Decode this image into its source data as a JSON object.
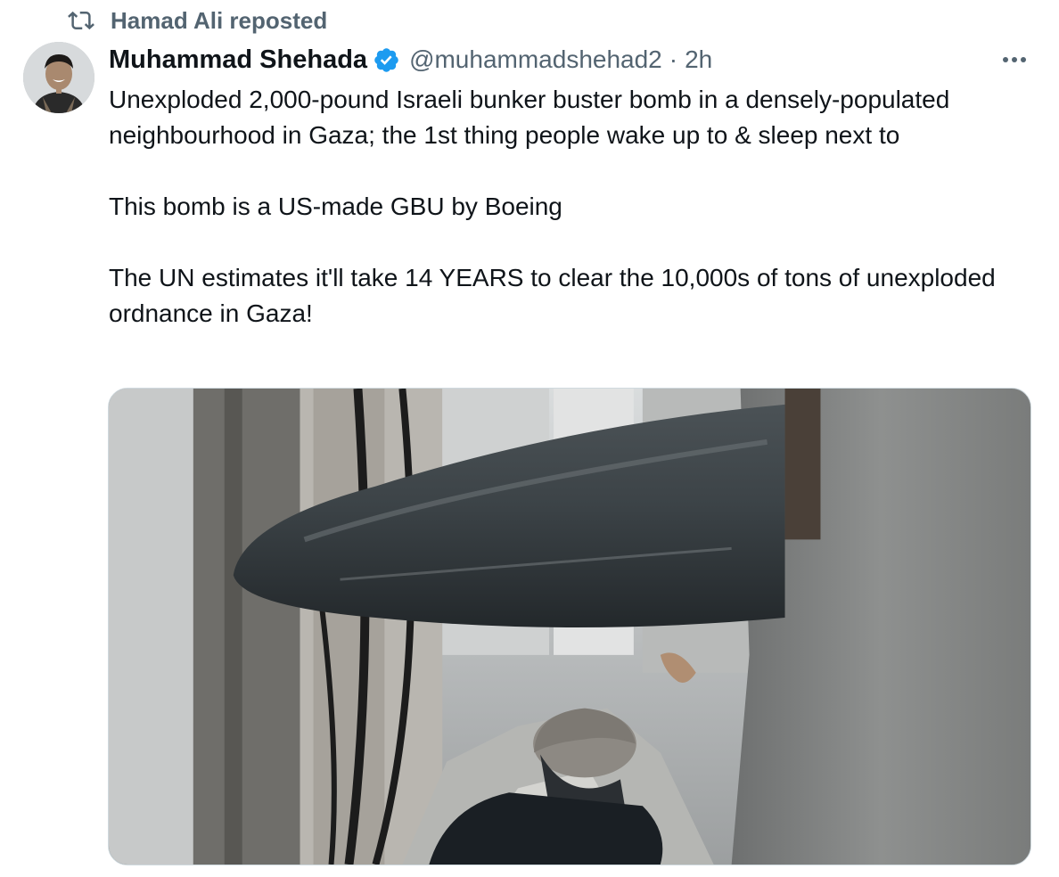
{
  "social_context": {
    "icon": "repost-icon",
    "text": "Hamad Ali reposted"
  },
  "tweet": {
    "author": {
      "display_name": "Muhammad Shehada",
      "verified": true,
      "handle": "@muhammadshehad2",
      "separator": "·",
      "time": "2h",
      "avatar_icon": "avatar"
    },
    "text_paragraphs": [
      "Unexploded 2,000-pound Israeli bunker buster bomb in a densely-populated neighbourhood in Gaza; the 1st thing people wake up to & sleep next to",
      "This bomb is a US-made GBU by Boeing",
      "The UN estimates it'll take 14 YEARS to clear the 10,000s of tons of unexploded ordnance in Gaza!"
    ],
    "more_icon": "more-horizontal-icon",
    "media_icon": "photo-image"
  },
  "colors": {
    "text_primary": "#0f1419",
    "text_secondary": "#536471",
    "verified_blue": "#1d9bf0",
    "border": "#cfd9de"
  }
}
